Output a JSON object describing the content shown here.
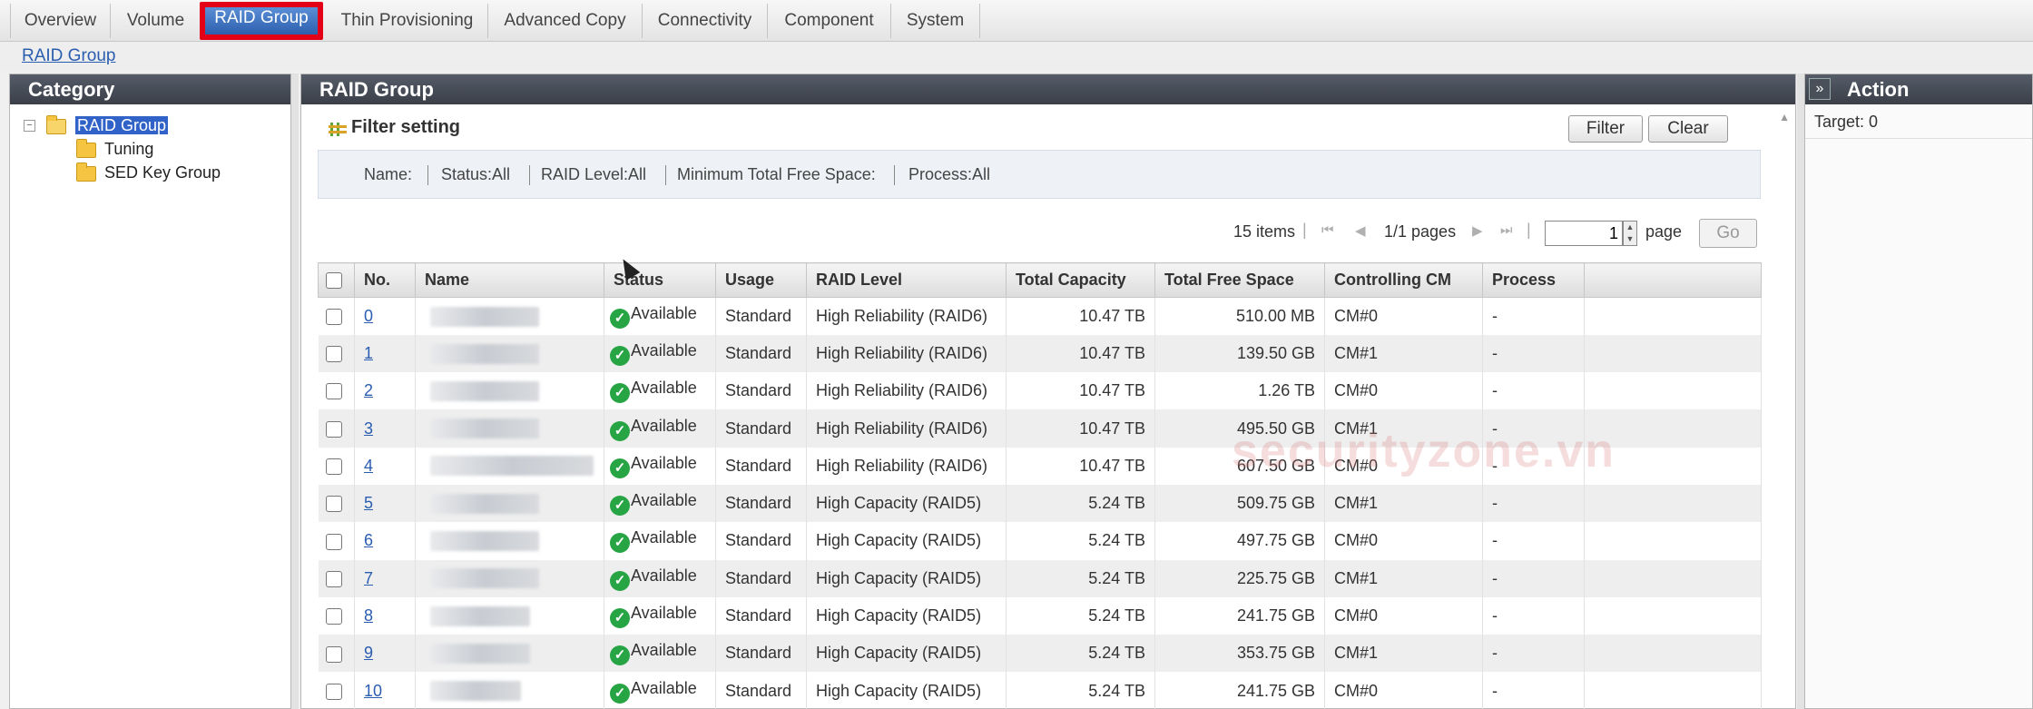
{
  "tabs": [
    {
      "label": "Overview",
      "active": false
    },
    {
      "label": "Volume",
      "active": false
    },
    {
      "label": "RAID Group",
      "active": true
    },
    {
      "label": "Thin Provisioning",
      "active": false
    },
    {
      "label": "Advanced Copy",
      "active": false
    },
    {
      "label": "Connectivity",
      "active": false
    },
    {
      "label": "Component",
      "active": false
    },
    {
      "label": "System",
      "active": false
    }
  ],
  "breadcrumb": "RAID Group",
  "category": {
    "title": "Category",
    "tree": [
      {
        "label": "RAID Group",
        "selected": true,
        "expanded": true,
        "toggle": "−"
      },
      {
        "label": "Tuning"
      },
      {
        "label": "SED Key Group"
      }
    ]
  },
  "main": {
    "title": "RAID Group",
    "filter": {
      "title": "Filter setting",
      "filter_button": "Filter",
      "clear_button": "Clear",
      "fields": [
        "Name:",
        "Status:All",
        "RAID Level:All",
        "Minimum Total Free Space:",
        "Process:All"
      ]
    },
    "pager": {
      "items": "15 items",
      "pages": "1/1 pages",
      "page_value": "1",
      "page_label": "page",
      "go_button": "Go"
    },
    "columns": [
      "No.",
      "Name",
      "Status",
      "Usage",
      "RAID Level",
      "Total Capacity",
      "Total Free Space",
      "Controlling CM",
      "Process"
    ],
    "rows": [
      {
        "no": "0",
        "status": "Available",
        "usage": "Standard",
        "raid_level": "High Reliability (RAID6)",
        "total_capacity": "10.47 TB",
        "free_space": "510.00 MB",
        "cm": "CM#0",
        "process": "-"
      },
      {
        "no": "1",
        "status": "Available",
        "usage": "Standard",
        "raid_level": "High Reliability (RAID6)",
        "total_capacity": "10.47 TB",
        "free_space": "139.50 GB",
        "cm": "CM#1",
        "process": "-"
      },
      {
        "no": "2",
        "status": "Available",
        "usage": "Standard",
        "raid_level": "High Reliability (RAID6)",
        "total_capacity": "10.47 TB",
        "free_space": "1.26 TB",
        "cm": "CM#0",
        "process": "-"
      },
      {
        "no": "3",
        "status": "Available",
        "usage": "Standard",
        "raid_level": "High Reliability (RAID6)",
        "total_capacity": "10.47 TB",
        "free_space": "495.50 GB",
        "cm": "CM#1",
        "process": "-"
      },
      {
        "no": "4",
        "status": "Available",
        "usage": "Standard",
        "raid_level": "High Reliability (RAID6)",
        "total_capacity": "10.47 TB",
        "free_space": "607.50 GB",
        "cm": "CM#0",
        "process": "-"
      },
      {
        "no": "5",
        "status": "Available",
        "usage": "Standard",
        "raid_level": "High Capacity (RAID5)",
        "total_capacity": "5.24 TB",
        "free_space": "509.75 GB",
        "cm": "CM#1",
        "process": "-"
      },
      {
        "no": "6",
        "status": "Available",
        "usage": "Standard",
        "raid_level": "High Capacity (RAID5)",
        "total_capacity": "5.24 TB",
        "free_space": "497.75 GB",
        "cm": "CM#0",
        "process": "-"
      },
      {
        "no": "7",
        "status": "Available",
        "usage": "Standard",
        "raid_level": "High Capacity (RAID5)",
        "total_capacity": "5.24 TB",
        "free_space": "225.75 GB",
        "cm": "CM#1",
        "process": "-"
      },
      {
        "no": "8",
        "status": "Available",
        "usage": "Standard",
        "raid_level": "High Capacity (RAID5)",
        "total_capacity": "5.24 TB",
        "free_space": "241.75 GB",
        "cm": "CM#0",
        "process": "-"
      },
      {
        "no": "9",
        "status": "Available",
        "usage": "Standard",
        "raid_level": "High Capacity (RAID5)",
        "total_capacity": "5.24 TB",
        "free_space": "353.75 GB",
        "cm": "CM#1",
        "process": "-"
      },
      {
        "no": "10",
        "status": "Available",
        "usage": "Standard",
        "raid_level": "High Capacity (RAID5)",
        "total_capacity": "5.24 TB",
        "free_space": "241.75 GB",
        "cm": "CM#0",
        "process": "-"
      }
    ]
  },
  "action": {
    "title": "Action",
    "collapse_glyph": "»",
    "target": "Target: 0"
  },
  "watermark": "securityzone.vn",
  "colors": {
    "header_dark": "#3a3f48",
    "active_tab": "#2d5fae",
    "highlight_border": "#e30016",
    "link": "#2a5db0",
    "ok_green": "#27a444"
  }
}
